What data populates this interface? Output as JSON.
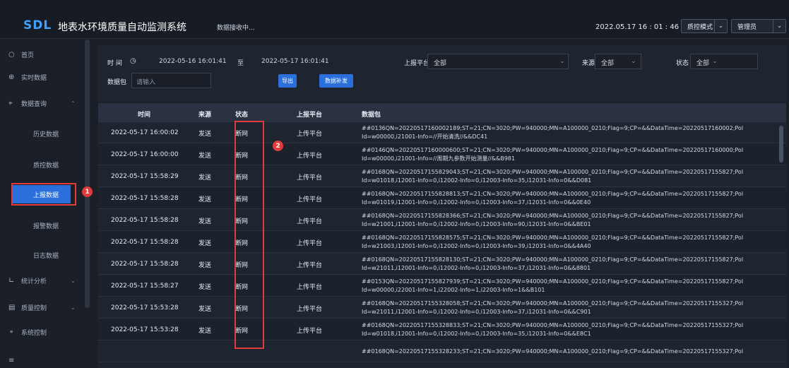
{
  "header": {
    "logo": "SDL",
    "title": "地表水环境质量自动监测系统",
    "receiving_status": "数据接收中...",
    "datetime": "2022.05.17  16 : 01 : 46",
    "mode_select": "质控模式",
    "user_select": "管理员"
  },
  "sidebar": {
    "home": "首页",
    "realtime": "实时数据",
    "query": "数据查询",
    "history": "历史数据",
    "qc_data": "质控数据",
    "report_data": "上报数据",
    "alarm_data": "报警数据",
    "log_data": "日志数据",
    "stats": "统计分析",
    "quality": "质量控制",
    "system": "系统控制",
    "marker1": "1"
  },
  "filter": {
    "time_label": "时 间",
    "start_time": "2022-05-16 16:01:41",
    "to": "至",
    "end_time": "2022-05-17 16:01:41",
    "platform_label": "上报平台",
    "platform_value": "全部",
    "source_label": "来源",
    "source_value": "全部",
    "status_label": "状态",
    "status_value": "全部",
    "packet_label": "数据包",
    "packet_placeholder": "请输入",
    "export_btn": "导出",
    "resend_btn": "数据补发"
  },
  "table": {
    "headers": [
      "时间",
      "来源",
      "状态",
      "上报平台",
      "数据包"
    ],
    "marker2": "2",
    "rows": [
      {
        "time": "2022-05-17 16:00:02",
        "source": "发送",
        "status": "断网",
        "platform": "上传平台",
        "l1": "##0136QN=20220517160002189;ST=21;CN=3020;PW=940000;MN=A100000_0210;Flag=9;CP=&&DataTime=20220517160002;Pol",
        "l2": "Id=w00000,i21001-Info=//开始清洗//&&DC41"
      },
      {
        "time": "2022-05-17 16:00:00",
        "source": "发送",
        "status": "断网",
        "platform": "上传平台",
        "l1": "##0146QN=20220517160000600;ST=21;CN=3020;PW=940000;MN=A100000_0210;Flag=9;CP=&&DataTime=20220517160000;Pol",
        "l2": "Id=w00000,i21001-Info=//周期九参数开始测量//&&B981"
      },
      {
        "time": "2022-05-17 15:58:29",
        "source": "发送",
        "status": "断网",
        "platform": "上传平台",
        "l1": "##0168QN=20220517155829043;ST=21;CN=3020;PW=940000;MN=A100000_0210;Flag=9;CP=&&DataTime=20220517155827;Pol",
        "l2": "Id=w01018,i12001-Info=0,i12002-Info=0,i12003-Info=35,i12031-Info=0&&D081"
      },
      {
        "time": "2022-05-17 15:58:28",
        "source": "发送",
        "status": "断网",
        "platform": "上传平台",
        "l1": "##0168QN=20220517155828813;ST=21;CN=3020;PW=940000;MN=A100000_0210;Flag=9;CP=&&DataTime=20220517155827;Pol",
        "l2": "Id=w01019,i12001-Info=0,i12002-Info=0,i12003-Info=37,i12031-Info=0&&0E40"
      },
      {
        "time": "2022-05-17 15:58:28",
        "source": "发送",
        "status": "断网",
        "platform": "上传平台",
        "l1": "##0168QN=20220517155828366;ST=21;CN=3020;PW=940000;MN=A100000_0210;Flag=9;CP=&&DataTime=20220517155827;Pol",
        "l2": "Id=w21001,i12001-Info=0,i12002-Info=0,i12003-Info=90,i12031-Info=0&&BE01"
      },
      {
        "time": "2022-05-17 15:58:28",
        "source": "发送",
        "status": "断网",
        "platform": "上传平台",
        "l1": "##0168QN=20220517155828575;ST=21;CN=3020;PW=940000;MN=A100000_0210;Flag=9;CP=&&DataTime=20220517155827;Pol",
        "l2": "Id=w21003,i12001-Info=0,i12002-Info=0,i12003-Info=39,i12031-Info=0&&4A40"
      },
      {
        "time": "2022-05-17 15:58:28",
        "source": "发送",
        "status": "断网",
        "platform": "上传平台",
        "l1": "##0168QN=20220517155828130;ST=21;CN=3020;PW=940000;MN=A100000_0210;Flag=9;CP=&&DataTime=20220517155827;Pol",
        "l2": "Id=w21011,i12001-Info=0,i12002-Info=0,i12003-Info=37,i12031-Info=0&&8801"
      },
      {
        "time": "2022-05-17 15:58:27",
        "source": "发送",
        "status": "断网",
        "platform": "上传平台",
        "l1": "##0153QN=20220517155827939;ST=21;CN=3020;PW=940000;MN=A100000_0210;Flag=9;CP=&&DataTime=20220517155827;Pol",
        "l2": "Id=w00000,i22001-Info=1,i22002-Info=1,i22003-Info=1&&B101"
      },
      {
        "time": "2022-05-17 15:53:28",
        "source": "发送",
        "status": "断网",
        "platform": "上传平台",
        "l1": "##0168QN=20220517155328058;ST=21;CN=3020;PW=940000;MN=A100000_0210;Flag=9;CP=&&DataTime=20220517155327;Pol",
        "l2": "Id=w21011,i12001-Info=0,i12002-Info=0,i12003-Info=37,i12031-Info=0&&C901"
      },
      {
        "time": "2022-05-17 15:53:28",
        "source": "发送",
        "status": "断网",
        "platform": "上传平台",
        "l1": "##0168QN=20220517155328833;ST=21;CN=3020;PW=940000;MN=A100000_0210;Flag=9;CP=&&DataTime=20220517155327;Pol",
        "l2": "Id=w01018,i12001-Info=0,i12002-Info=0,i12003-Info=35,i12031-Info=0&&E8C1"
      },
      {
        "time": "",
        "source": "",
        "status": "",
        "platform": "",
        "l1": "##0168QN=20220517155328233;ST=21;CN=3020;PW=940000;MN=A100000_0210;Flag=9;CP=&&DataTime=20220517155327;Pol",
        "l2": ""
      }
    ]
  },
  "colors": {
    "accent": "#2a6fdb",
    "highlight_box": "#e23b3b",
    "logo": "#3fa2ff"
  }
}
